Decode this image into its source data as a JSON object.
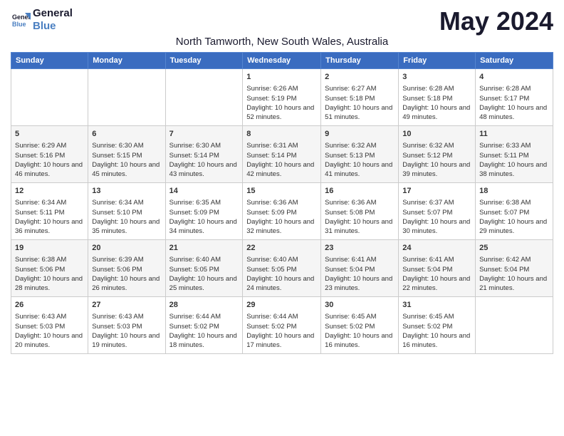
{
  "header": {
    "logo_line1": "General",
    "logo_line2": "Blue",
    "title": "May 2024",
    "subtitle": "North Tamworth, New South Wales, Australia"
  },
  "days_of_week": [
    "Sunday",
    "Monday",
    "Tuesday",
    "Wednesday",
    "Thursday",
    "Friday",
    "Saturday"
  ],
  "weeks": [
    [
      {
        "day": "",
        "text": ""
      },
      {
        "day": "",
        "text": ""
      },
      {
        "day": "",
        "text": ""
      },
      {
        "day": "1",
        "text": "Sunrise: 6:26 AM\nSunset: 5:19 PM\nDaylight: 10 hours and 52 minutes."
      },
      {
        "day": "2",
        "text": "Sunrise: 6:27 AM\nSunset: 5:18 PM\nDaylight: 10 hours and 51 minutes."
      },
      {
        "day": "3",
        "text": "Sunrise: 6:28 AM\nSunset: 5:18 PM\nDaylight: 10 hours and 49 minutes."
      },
      {
        "day": "4",
        "text": "Sunrise: 6:28 AM\nSunset: 5:17 PM\nDaylight: 10 hours and 48 minutes."
      }
    ],
    [
      {
        "day": "5",
        "text": "Sunrise: 6:29 AM\nSunset: 5:16 PM\nDaylight: 10 hours and 46 minutes."
      },
      {
        "day": "6",
        "text": "Sunrise: 6:30 AM\nSunset: 5:15 PM\nDaylight: 10 hours and 45 minutes."
      },
      {
        "day": "7",
        "text": "Sunrise: 6:30 AM\nSunset: 5:14 PM\nDaylight: 10 hours and 43 minutes."
      },
      {
        "day": "8",
        "text": "Sunrise: 6:31 AM\nSunset: 5:14 PM\nDaylight: 10 hours and 42 minutes."
      },
      {
        "day": "9",
        "text": "Sunrise: 6:32 AM\nSunset: 5:13 PM\nDaylight: 10 hours and 41 minutes."
      },
      {
        "day": "10",
        "text": "Sunrise: 6:32 AM\nSunset: 5:12 PM\nDaylight: 10 hours and 39 minutes."
      },
      {
        "day": "11",
        "text": "Sunrise: 6:33 AM\nSunset: 5:11 PM\nDaylight: 10 hours and 38 minutes."
      }
    ],
    [
      {
        "day": "12",
        "text": "Sunrise: 6:34 AM\nSunset: 5:11 PM\nDaylight: 10 hours and 36 minutes."
      },
      {
        "day": "13",
        "text": "Sunrise: 6:34 AM\nSunset: 5:10 PM\nDaylight: 10 hours and 35 minutes."
      },
      {
        "day": "14",
        "text": "Sunrise: 6:35 AM\nSunset: 5:09 PM\nDaylight: 10 hours and 34 minutes."
      },
      {
        "day": "15",
        "text": "Sunrise: 6:36 AM\nSunset: 5:09 PM\nDaylight: 10 hours and 32 minutes."
      },
      {
        "day": "16",
        "text": "Sunrise: 6:36 AM\nSunset: 5:08 PM\nDaylight: 10 hours and 31 minutes."
      },
      {
        "day": "17",
        "text": "Sunrise: 6:37 AM\nSunset: 5:07 PM\nDaylight: 10 hours and 30 minutes."
      },
      {
        "day": "18",
        "text": "Sunrise: 6:38 AM\nSunset: 5:07 PM\nDaylight: 10 hours and 29 minutes."
      }
    ],
    [
      {
        "day": "19",
        "text": "Sunrise: 6:38 AM\nSunset: 5:06 PM\nDaylight: 10 hours and 28 minutes."
      },
      {
        "day": "20",
        "text": "Sunrise: 6:39 AM\nSunset: 5:06 PM\nDaylight: 10 hours and 26 minutes."
      },
      {
        "day": "21",
        "text": "Sunrise: 6:40 AM\nSunset: 5:05 PM\nDaylight: 10 hours and 25 minutes."
      },
      {
        "day": "22",
        "text": "Sunrise: 6:40 AM\nSunset: 5:05 PM\nDaylight: 10 hours and 24 minutes."
      },
      {
        "day": "23",
        "text": "Sunrise: 6:41 AM\nSunset: 5:04 PM\nDaylight: 10 hours and 23 minutes."
      },
      {
        "day": "24",
        "text": "Sunrise: 6:41 AM\nSunset: 5:04 PM\nDaylight: 10 hours and 22 minutes."
      },
      {
        "day": "25",
        "text": "Sunrise: 6:42 AM\nSunset: 5:04 PM\nDaylight: 10 hours and 21 minutes."
      }
    ],
    [
      {
        "day": "26",
        "text": "Sunrise: 6:43 AM\nSunset: 5:03 PM\nDaylight: 10 hours and 20 minutes."
      },
      {
        "day": "27",
        "text": "Sunrise: 6:43 AM\nSunset: 5:03 PM\nDaylight: 10 hours and 19 minutes."
      },
      {
        "day": "28",
        "text": "Sunrise: 6:44 AM\nSunset: 5:02 PM\nDaylight: 10 hours and 18 minutes."
      },
      {
        "day": "29",
        "text": "Sunrise: 6:44 AM\nSunset: 5:02 PM\nDaylight: 10 hours and 17 minutes."
      },
      {
        "day": "30",
        "text": "Sunrise: 6:45 AM\nSunset: 5:02 PM\nDaylight: 10 hours and 16 minutes."
      },
      {
        "day": "31",
        "text": "Sunrise: 6:45 AM\nSunset: 5:02 PM\nDaylight: 10 hours and 16 minutes."
      },
      {
        "day": "",
        "text": ""
      }
    ]
  ]
}
